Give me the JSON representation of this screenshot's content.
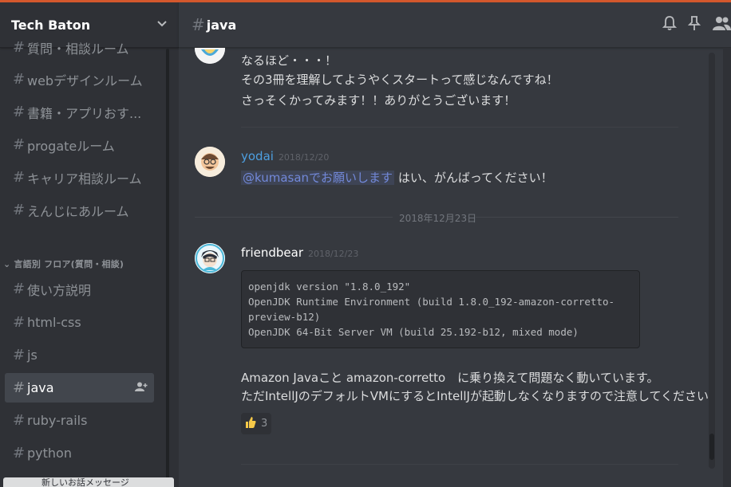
{
  "server": {
    "name": "Tech Baton",
    "menu_icon": "chevron-down-icon"
  },
  "sidebar": {
    "channels_top": [
      {
        "label": "質問・相談ルーム"
      },
      {
        "label": "webデザインルーム"
      },
      {
        "label": "書籍・アプリおす..."
      },
      {
        "label": "progateルーム"
      },
      {
        "label": "キャリア相談ルーム"
      },
      {
        "label": "えんじにあルーム"
      }
    ],
    "category": "言語別 フロア(質問・相談)",
    "channels_lang": [
      {
        "label": "使い方説明"
      },
      {
        "label": "html-css"
      },
      {
        "label": "js"
      },
      {
        "label": "java"
      },
      {
        "label": "ruby-rails"
      },
      {
        "label": "python"
      }
    ],
    "new_messages_label": "新しいお話メッセージ"
  },
  "header": {
    "channel": "java",
    "icons": [
      "bell-icon",
      "pin-icon",
      "members-icon"
    ]
  },
  "messages": {
    "prev_lines": [
      "なるほど・・・！",
      "その3冊を理解してようやくスタートって感じなんですね！",
      "さっそくかってみます！！ありがとうございます！"
    ],
    "yodai": {
      "username": "yodai",
      "timestamp": "2018/12/20",
      "mention": "@kumasanでお願いします",
      "text": " はい、がんばってください！",
      "color": "#4d9fe0"
    },
    "date_separator": "2018年12月23日",
    "friendbear": {
      "username": "friendbear",
      "timestamp": "2018/12/23",
      "code": [
        "openjdk version \"1.8.0_192\"",
        "OpenJDK Runtime Environment (build 1.8.0_192-amazon-corretto-",
        "preview-b12)",
        "OpenJDK 64-Bit Server VM (build 25.192-b12, mixed mode)"
      ],
      "line1": "Amazon Javaこと amazon-corretto　に乗り換えて問題なく動いています。",
      "line2": "ただIntellJのデフォルトVMにするとIntellJが起動しなくなりますので注意してください。",
      "reaction_icon": "thumbs-up-icon",
      "reaction_count": "3",
      "color": "#ffffff"
    }
  },
  "colors": {
    "accent": "#d4582d",
    "mention": "#7289da",
    "background": "#36393f",
    "sidebar": "#2f3136"
  }
}
